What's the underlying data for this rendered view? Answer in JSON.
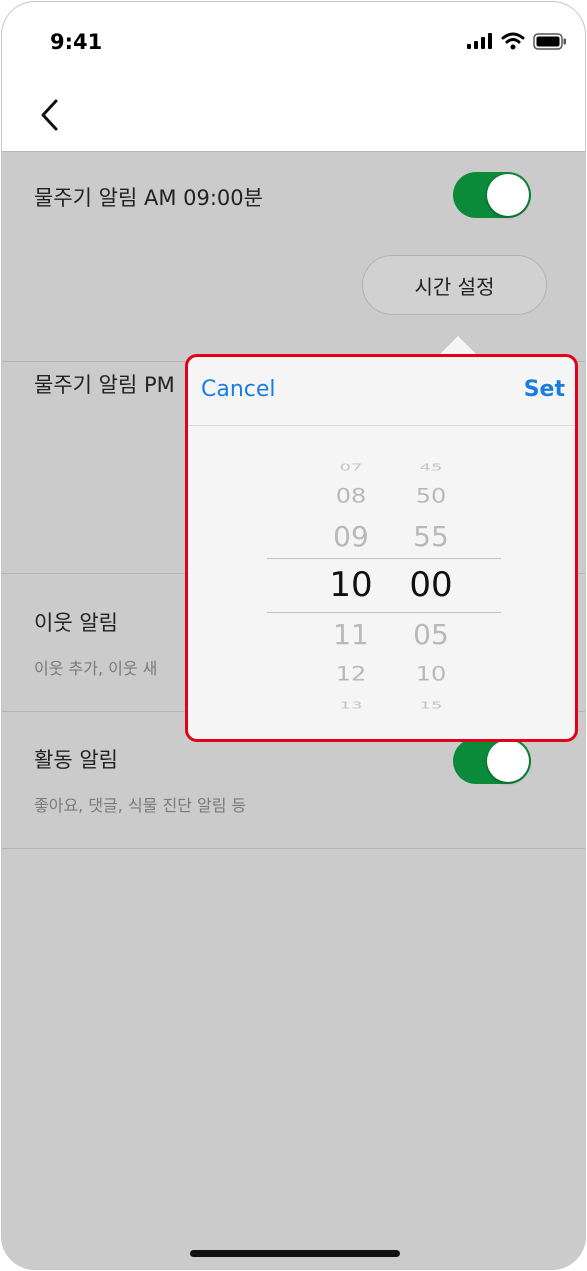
{
  "status_bar": {
    "time": "9:41",
    "icons": [
      "signal-icon",
      "wifi-icon",
      "battery-icon"
    ]
  },
  "nav": {
    "back_icon": "chevron-left-icon"
  },
  "rows": [
    {
      "title": "물주기 알림 AM 09:00분",
      "toggle_on": true,
      "time_button": "시간 설정"
    },
    {
      "title": "물주기 알림 PM"
    },
    {
      "title": "이웃 알림",
      "subtitle": "이웃 추가, 이웃 새"
    },
    {
      "title": "활동 알림",
      "subtitle": "좋아요, 댓글, 식물 진단 알림 등",
      "toggle_on": true
    }
  ],
  "picker": {
    "cancel_label": "Cancel",
    "set_label": "Set",
    "hours": [
      "07",
      "08",
      "09",
      "10",
      "11",
      "12",
      "13"
    ],
    "minutes": [
      "45",
      "50",
      "55",
      "00",
      "05",
      "10",
      "15"
    ],
    "selected_hour": "10",
    "selected_minute": "00"
  },
  "colors": {
    "accent": "#1a7ee0",
    "toggle_on": "#0b8a3a",
    "highlight": "#e3001b",
    "overlay": "#cbcbcb"
  }
}
